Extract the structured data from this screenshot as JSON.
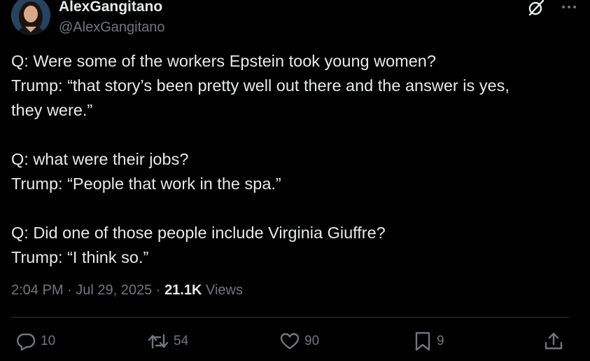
{
  "author": {
    "display_name": "AlexGangitano",
    "handle": "@AlexGangitano"
  },
  "tweet": {
    "lines": [
      "Q: Were some of the workers Epstein took young women?",
      "Trump: “that story’s been pretty well out there and the answer is yes,",
      "they were.”",
      "",
      "Q: what were their jobs?",
      "Trump: “People that work in the spa.”",
      "",
      "Q: Did one of those people include Virginia Giuffre?",
      "Trump: “I think so.”"
    ],
    "time": "2:04 PM",
    "date": "Jul 29, 2025",
    "separator": "·",
    "views_count": "21.1K",
    "views_label": "Views"
  },
  "actions": {
    "reply_count": "10",
    "repost_count": "54",
    "like_count": "90",
    "bookmark_count": "9"
  },
  "icons": {
    "header": [
      "grok-icon",
      "more-icon"
    ],
    "actions": [
      "reply-icon",
      "repost-icon",
      "like-icon",
      "bookmark-icon",
      "share-icon"
    ]
  },
  "colors": {
    "background": "#000000",
    "primary_text": "#e7e9ea",
    "secondary_text": "#71767b",
    "divider": "#2f3336"
  }
}
